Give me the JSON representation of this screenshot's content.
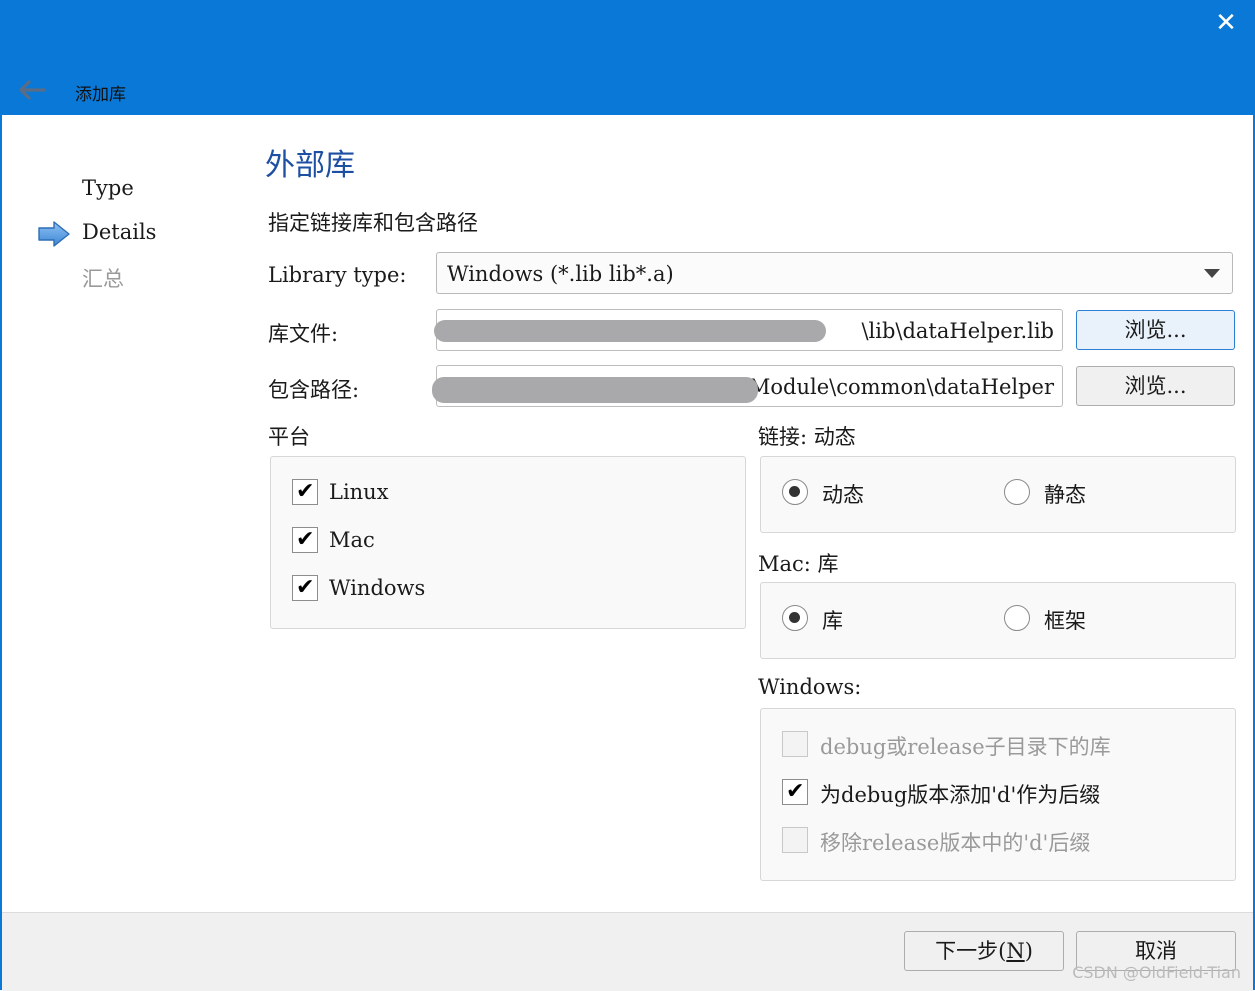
{
  "window": {
    "title": "添加库",
    "close_glyph": "✕",
    "accent": "#0a78d7"
  },
  "steps": {
    "items": [
      "Type",
      "Details",
      "汇总"
    ],
    "current": "Details"
  },
  "page": {
    "heading": "外部库",
    "subtitle": "指定链接库和包含路径"
  },
  "library_type": {
    "label": "Library type:",
    "value": "Windows (*.lib lib*.a)"
  },
  "library_file": {
    "label": "库文件:",
    "value": "\\lib\\dataHelper.lib",
    "browse_label": "浏览..."
  },
  "include_path": {
    "label": "包含路径:",
    "value": "\\Module\\common\\dataHelper",
    "browse_label": "浏览..."
  },
  "platform": {
    "title": "平台",
    "options": [
      {
        "label": "Linux",
        "checked": true
      },
      {
        "label": "Mac",
        "checked": true
      },
      {
        "label": "Windows",
        "checked": true
      }
    ]
  },
  "linkage": {
    "title": "链接: 动态",
    "options": [
      {
        "label": "动态",
        "selected": true
      },
      {
        "label": "静态",
        "selected": false
      }
    ]
  },
  "mac": {
    "title": "Mac: 库",
    "options": [
      {
        "label": "库",
        "selected": true
      },
      {
        "label": "框架",
        "selected": false
      }
    ]
  },
  "windows": {
    "title": "Windows:",
    "options": [
      {
        "label": "debug或release子目录下的库",
        "checked": false,
        "enabled": false
      },
      {
        "label": "为debug版本添加'd'作为后缀",
        "checked": true,
        "enabled": true
      },
      {
        "label": "移除release版本中的'd'后缀",
        "checked": false,
        "enabled": false
      }
    ]
  },
  "footer": {
    "next_label": "下一步(",
    "next_mnemonic": "N",
    "next_close": ")",
    "cancel_label": "取消"
  },
  "watermark": "CSDN @OldField-Tian",
  "icons": {
    "back": "back-arrow-icon",
    "current_step": "arrow-right-icon",
    "check": "✔"
  }
}
